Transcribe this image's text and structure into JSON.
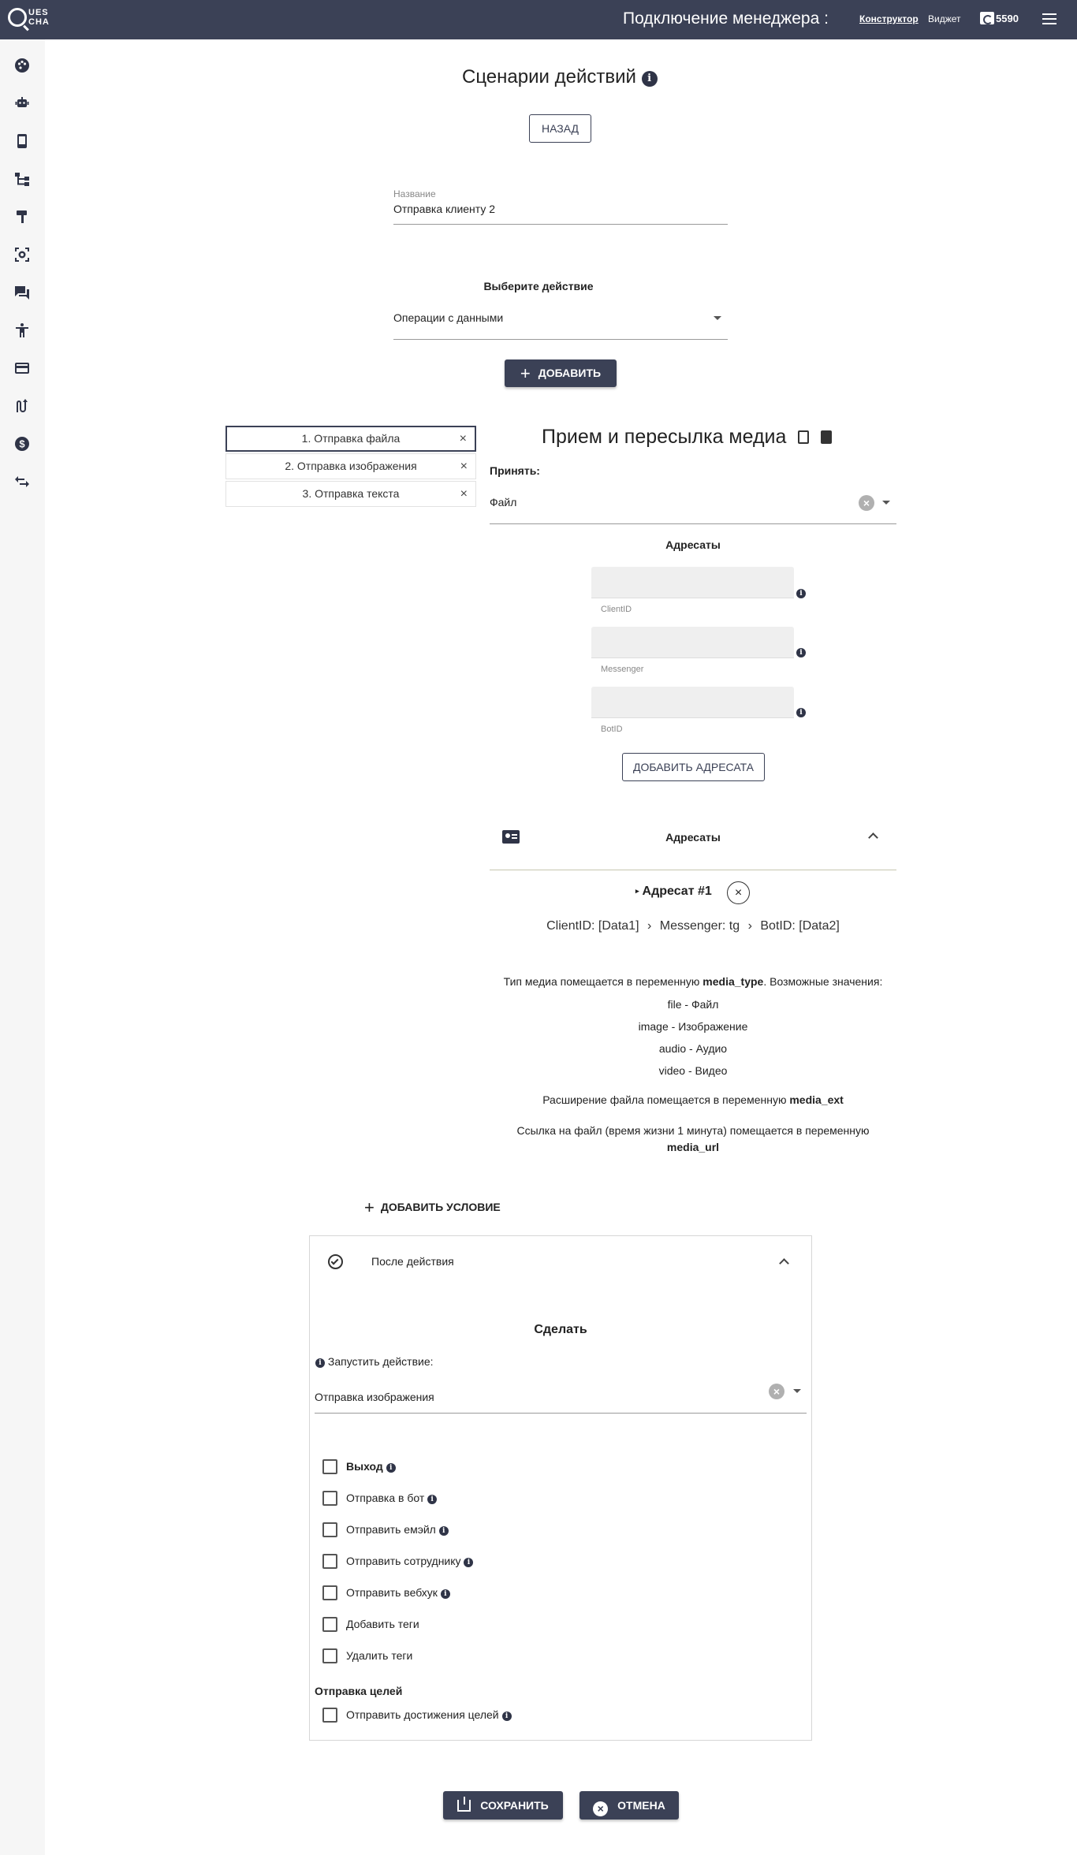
{
  "header": {
    "logo_line1": "UES",
    "logo_line2": "CHA",
    "title": "Подключение менеджера :",
    "link_constructor": "Конструктор",
    "link_widget": "Виджет",
    "balance": "5590"
  },
  "sidebar": {
    "icons": [
      "palette-icon",
      "robot-icon",
      "mobile-icon",
      "hierarchy-icon",
      "brush-icon",
      "camera-frame-icon",
      "chat-icon",
      "accessibility-icon",
      "credit-card-icon",
      "route-icon",
      "dollar-icon",
      "swap-icon"
    ]
  },
  "main": {
    "title": "Сценарии действий",
    "back_button": "НАЗАД",
    "name_label": "Название",
    "name_value": "Отправка клиенту 2",
    "choose_action_title": "Выберите действие",
    "action_select_value": "Операции с данными",
    "add_button": "ДОБАВИТЬ"
  },
  "steps": [
    {
      "label": "1. Отправка файла"
    },
    {
      "label": "2. Отправка изображения"
    },
    {
      "label": "3. Отправка текста"
    }
  ],
  "media": {
    "title": "Прием и пересылка медиа",
    "accept_label": "Принять:",
    "accept_value": "Файл",
    "recipients_title": "Адресаты",
    "field_client": "ClientID",
    "field_messenger": "Messenger",
    "field_bot": "BotID",
    "add_recipient_button": "ДОБАВИТЬ АДРЕСАТА",
    "panel_title": "Адресаты",
    "recipient_name": "Адресат #1",
    "recipient_client": "ClientID: [Data1]",
    "recipient_messenger": "Messenger: tg",
    "recipient_bot": "BotID: [Data2]",
    "info_type_prefix": "Тип медиа помещается в переменную ",
    "info_type_var": "media_type",
    "info_type_suffix": ". Возможные значения:",
    "values": [
      {
        "key": "file",
        "label": " - Файл"
      },
      {
        "key": "image",
        "label": " - Изображение"
      },
      {
        "key": "audio",
        "label": " - Аудио"
      },
      {
        "key": "video",
        "label": " - Видео"
      }
    ],
    "ext_prefix": "Расширение файла помещается в переменную ",
    "ext_var": "media_ext",
    "url_text": "Ссылка на файл (время жизни 1 минута) помещается в переменную",
    "url_var": "media_url"
  },
  "condition": {
    "add_condition_button": "ДОБАВИТЬ УСЛОВИЕ",
    "after_action_title": "После действия",
    "do_title": "Сделать",
    "run_action_label": "Запустить действие:",
    "run_action_value": "Отправка изображения",
    "checkboxes": [
      {
        "label": "Выход",
        "info": true
      },
      {
        "label": "Отправка в бот",
        "info": true
      },
      {
        "label": "Отправить емэйл",
        "info": true
      },
      {
        "label": "Отправить сотруднику",
        "info": true
      },
      {
        "label": "Отправить вебхук",
        "info": true
      },
      {
        "label": "Добавить теги",
        "info": false
      },
      {
        "label": "Удалить теги",
        "info": false
      }
    ],
    "goals_title": "Отправка целей",
    "goals_checkbox": "Отправить достижения целей"
  },
  "footer": {
    "save_button": "СОХРАНИТЬ",
    "cancel_button": "ОТМЕНА"
  },
  "colors": {
    "header_bg": "#3b4156",
    "accent": "#3b4156",
    "sidebar_bg": "#f6f6f6"
  }
}
